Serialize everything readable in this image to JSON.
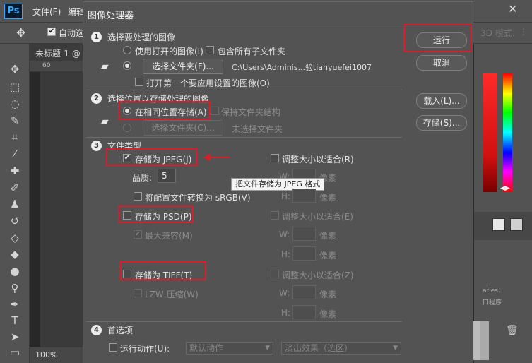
{
  "photoshop": {
    "logo": "Ps",
    "menus": [
      "文件(F)",
      "编辑"
    ],
    "window_controls": {
      "minimize": "—",
      "close": "✕"
    },
    "options_bar": {
      "auto_select_label": "自动选",
      "mode_text": "3D 模式:"
    },
    "document_tab": "未标题-1 @",
    "ruler_start": "60",
    "zoom": "100%",
    "panel_text": [
      "aries.",
      "口程序"
    ]
  },
  "dialog": {
    "title": "图像处理器",
    "buttons": {
      "run": "运行",
      "cancel": "取消",
      "load": "载入(L)...",
      "save": "存储(S)..."
    },
    "section1": {
      "number": "1",
      "heading": "选择要处理的图像",
      "use_open_images": "使用打开的图像(I)",
      "include_subfolders": "包含所有子文件夹",
      "select_folder_button": "选择文件夹(F)...",
      "folder_path": "C:\\Users\\Adminis...验tianyuefei1007",
      "open_first_image": "打开第一个要应用设置的图像(O)"
    },
    "section2": {
      "number": "2",
      "heading": "选择位置以存储处理的图像",
      "save_same_location": "在相同位置存储(A)",
      "keep_folder_structure": "保持文件夹结构",
      "select_folder_button": "选择文件夹(C)...",
      "no_folder_selected": "未选择文件夹"
    },
    "section3": {
      "number": "3",
      "heading": "文件类型",
      "save_jpeg": "存储为 JPEG(J)",
      "resize_to_fit_r": "调整大小以适合(R)",
      "quality_label": "品质:",
      "quality_value": "5",
      "w_label": "W:",
      "h_label": "H:",
      "pixel_unit": "像素",
      "convert_srgb": "将配置文件转换为 sRGB(V)",
      "save_psd": "存储为 PSD(P)",
      "resize_to_fit_e": "调整大小以适合(E)",
      "max_compat": "最大兼容(M)",
      "save_tiff": "存储为 TIFF(T)",
      "resize_to_fit_z": "调整大小以适合(Z)",
      "lzw": "LZW 压缩(W)"
    },
    "tooltip": "把文件存储为 JPEG 格式",
    "section4": {
      "number": "4",
      "heading": "首选项",
      "run_action": "运行动作(U):",
      "action_set": "默认动作",
      "action": "淡出效果（选区）"
    }
  }
}
